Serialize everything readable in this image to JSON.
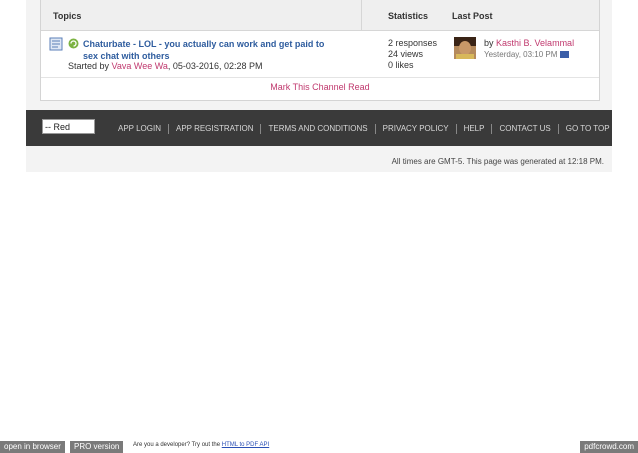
{
  "table": {
    "headers": {
      "topics": "Topics",
      "statistics": "Statistics",
      "last_post": "Last Post"
    },
    "thread": {
      "title": "Chaturbate - LOL - you actually can work and get paid to sex chat with others",
      "started_prefix": "Started by",
      "author": "Vava Wee Wa",
      "started_date": ", 05-03-2016, 02:28 PM",
      "responses": "2 responses",
      "views": "24 views",
      "likes": "0 likes",
      "last_post_by_prefix": "by",
      "last_post_user": "Kasthi B. Velammal",
      "last_post_date": "Yesterday, 03:10 PM"
    },
    "mark_read": "Mark This Channel Read"
  },
  "footer": {
    "style_selected": "-- Red",
    "links": [
      "APP LOGIN",
      "APP REGISTRATION",
      "TERMS AND CONDITIONS",
      "PRIVACY POLICY",
      "HELP",
      "CONTACT US",
      "GO TO TOP"
    ],
    "timestamp": "All times are GMT-5. This page was generated at 12:18 PM."
  },
  "pdfcrowd": {
    "open_in_browser": "open in browser",
    "pro_version": "PRO version",
    "promo_text": "Are you a developer? Try out the",
    "api_link": "HTML to PDF API",
    "brand": "pdfcrowd.com"
  },
  "colors": {
    "link_blue": "#2e5c9e",
    "user_pink": "#c0396e",
    "footer_dark": "#3a3a3a"
  }
}
